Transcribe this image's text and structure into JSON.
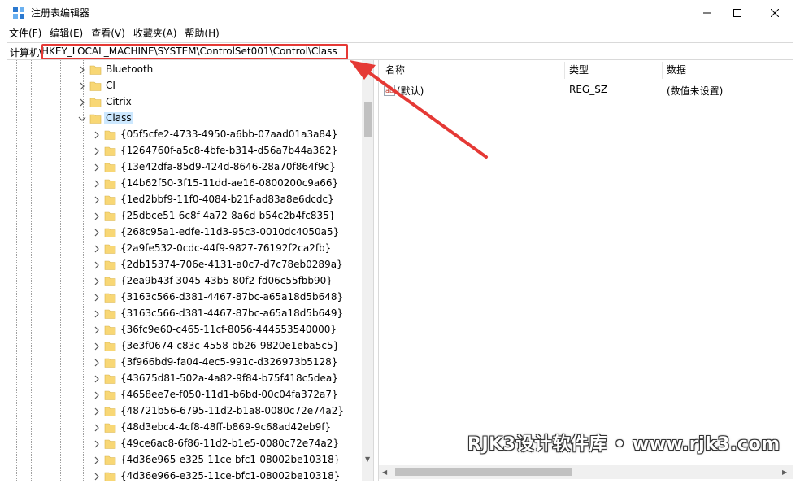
{
  "window": {
    "title": "注册表编辑器",
    "minimize_icon": "minimize-icon",
    "maximize_icon": "maximize-icon",
    "close_icon": "close-icon"
  },
  "menu": [
    "文件(F)",
    "编辑(E)",
    "查看(V)",
    "收藏夹(A)",
    "帮助(H)"
  ],
  "address": {
    "label": "计算机\\",
    "path": "HKEY_LOCAL_MACHINE\\SYSTEM\\ControlSet001\\Control\\Class"
  },
  "tree": {
    "parents": [
      {
        "label": "Bluetooth",
        "expanded": false
      },
      {
        "label": "CI",
        "expanded": false
      },
      {
        "label": "Citrix",
        "expanded": false
      },
      {
        "label": "Class",
        "expanded": true,
        "selected": true
      }
    ],
    "children": [
      "{05f5cfe2-4733-4950-a6bb-07aad01a3a84}",
      "{1264760f-a5c8-4bfe-b314-d56a7b44a362}",
      "{13e42dfa-85d9-424d-8646-28a70f864f9c}",
      "{14b62f50-3f15-11dd-ae16-0800200c9a66}",
      "{1ed2bbf9-11f0-4084-b21f-ad83a8e6dcdc}",
      "{25dbce51-6c8f-4a72-8a6d-b54c2b4fc835}",
      "{268c95a1-edfe-11d3-95c3-0010dc4050a5}",
      "{2a9fe532-0cdc-44f9-9827-76192f2ca2fb}",
      "{2db15374-706e-4131-a0c7-d7c78eb0289a}",
      "{2ea9b43f-3045-43b5-80f2-fd06c55fbb90}",
      "{3163c566-d381-4467-87bc-a65a18d5b648}",
      "{3163c566-d381-4467-87bc-a65a18d5b649}",
      "{36fc9e60-c465-11cf-8056-444553540000}",
      "{3e3f0674-c83c-4558-bb26-9820e1eba5c5}",
      "{3f966bd9-fa04-4ec5-991c-d326973b5128}",
      "{43675d81-502a-4a82-9f84-b75f418c5dea}",
      "{4658ee7e-f050-11d1-b6bd-00c04fa372a7}",
      "{48721b56-6795-11d2-b1a8-0080c72e74a2}",
      "{48d3ebc4-4cf8-48ff-b869-9c68ad42eb9f}",
      "{49ce6ac8-6f86-11d2-b1e5-0080c72e74a2}",
      "{4d36e965-e325-11ce-bfc1-08002be10318}",
      "{4d36e966-e325-11ce-bfc1-08002be10318}"
    ]
  },
  "list": {
    "headers": {
      "name": "名称",
      "type": "类型",
      "data": "数据"
    },
    "rows": [
      {
        "name": "(默认)",
        "type": "REG_SZ",
        "data": "(数值未设置)",
        "icon": "string-value-icon"
      }
    ]
  },
  "colors": {
    "highlight_border": "#e53935",
    "arrow": "#e53935",
    "selection": "#cce8ff",
    "folder": "#f8d775"
  },
  "watermark": "RJK3设计软件库 • www.rjk3.com"
}
